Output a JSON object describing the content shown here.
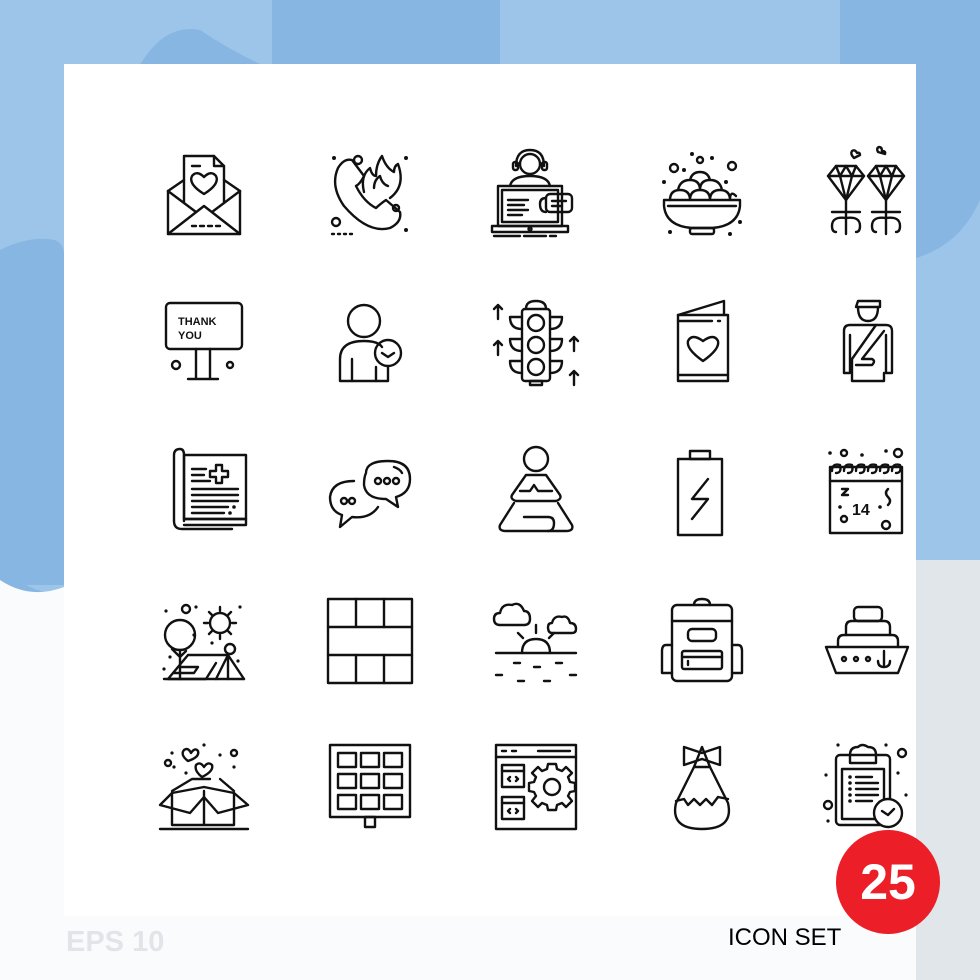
{
  "colors": {
    "bg_light_blue": "#9dc5e9",
    "bg_mid_blue": "#88b6e2",
    "bg_gray": "#e1e6ea",
    "panel": "#ffffff",
    "icon_stroke": "#111111",
    "badge": "#ec1e27"
  },
  "footer": {
    "format_label": "EPS 10",
    "set_label": "ICON SET",
    "count_badge": "25"
  },
  "icons": [
    {
      "name": "love-letter-icon"
    },
    {
      "name": "phone-fire-icon"
    },
    {
      "name": "online-support-icon"
    },
    {
      "name": "sweets-bowl-icon"
    },
    {
      "name": "diamond-rings-icon"
    },
    {
      "name": "thank-you-sign-icon",
      "text_line1": "THANK",
      "text_line2": "YOU"
    },
    {
      "name": "user-clock-icon"
    },
    {
      "name": "traffic-light-icon"
    },
    {
      "name": "greeting-card-icon"
    },
    {
      "name": "police-officer-icon"
    },
    {
      "name": "medical-book-icon"
    },
    {
      "name": "chat-bubbles-icon"
    },
    {
      "name": "meditation-icon"
    },
    {
      "name": "battery-charge-icon"
    },
    {
      "name": "valentine-calendar-icon",
      "text": "14"
    },
    {
      "name": "camping-tent-icon"
    },
    {
      "name": "grid-layout-icon"
    },
    {
      "name": "sunrise-icon"
    },
    {
      "name": "backpack-icon"
    },
    {
      "name": "ship-icon"
    },
    {
      "name": "love-gift-box-icon"
    },
    {
      "name": "solar-panel-icon"
    },
    {
      "name": "web-code-settings-icon"
    },
    {
      "name": "bomb-icon"
    },
    {
      "name": "clipboard-time-icon"
    }
  ]
}
